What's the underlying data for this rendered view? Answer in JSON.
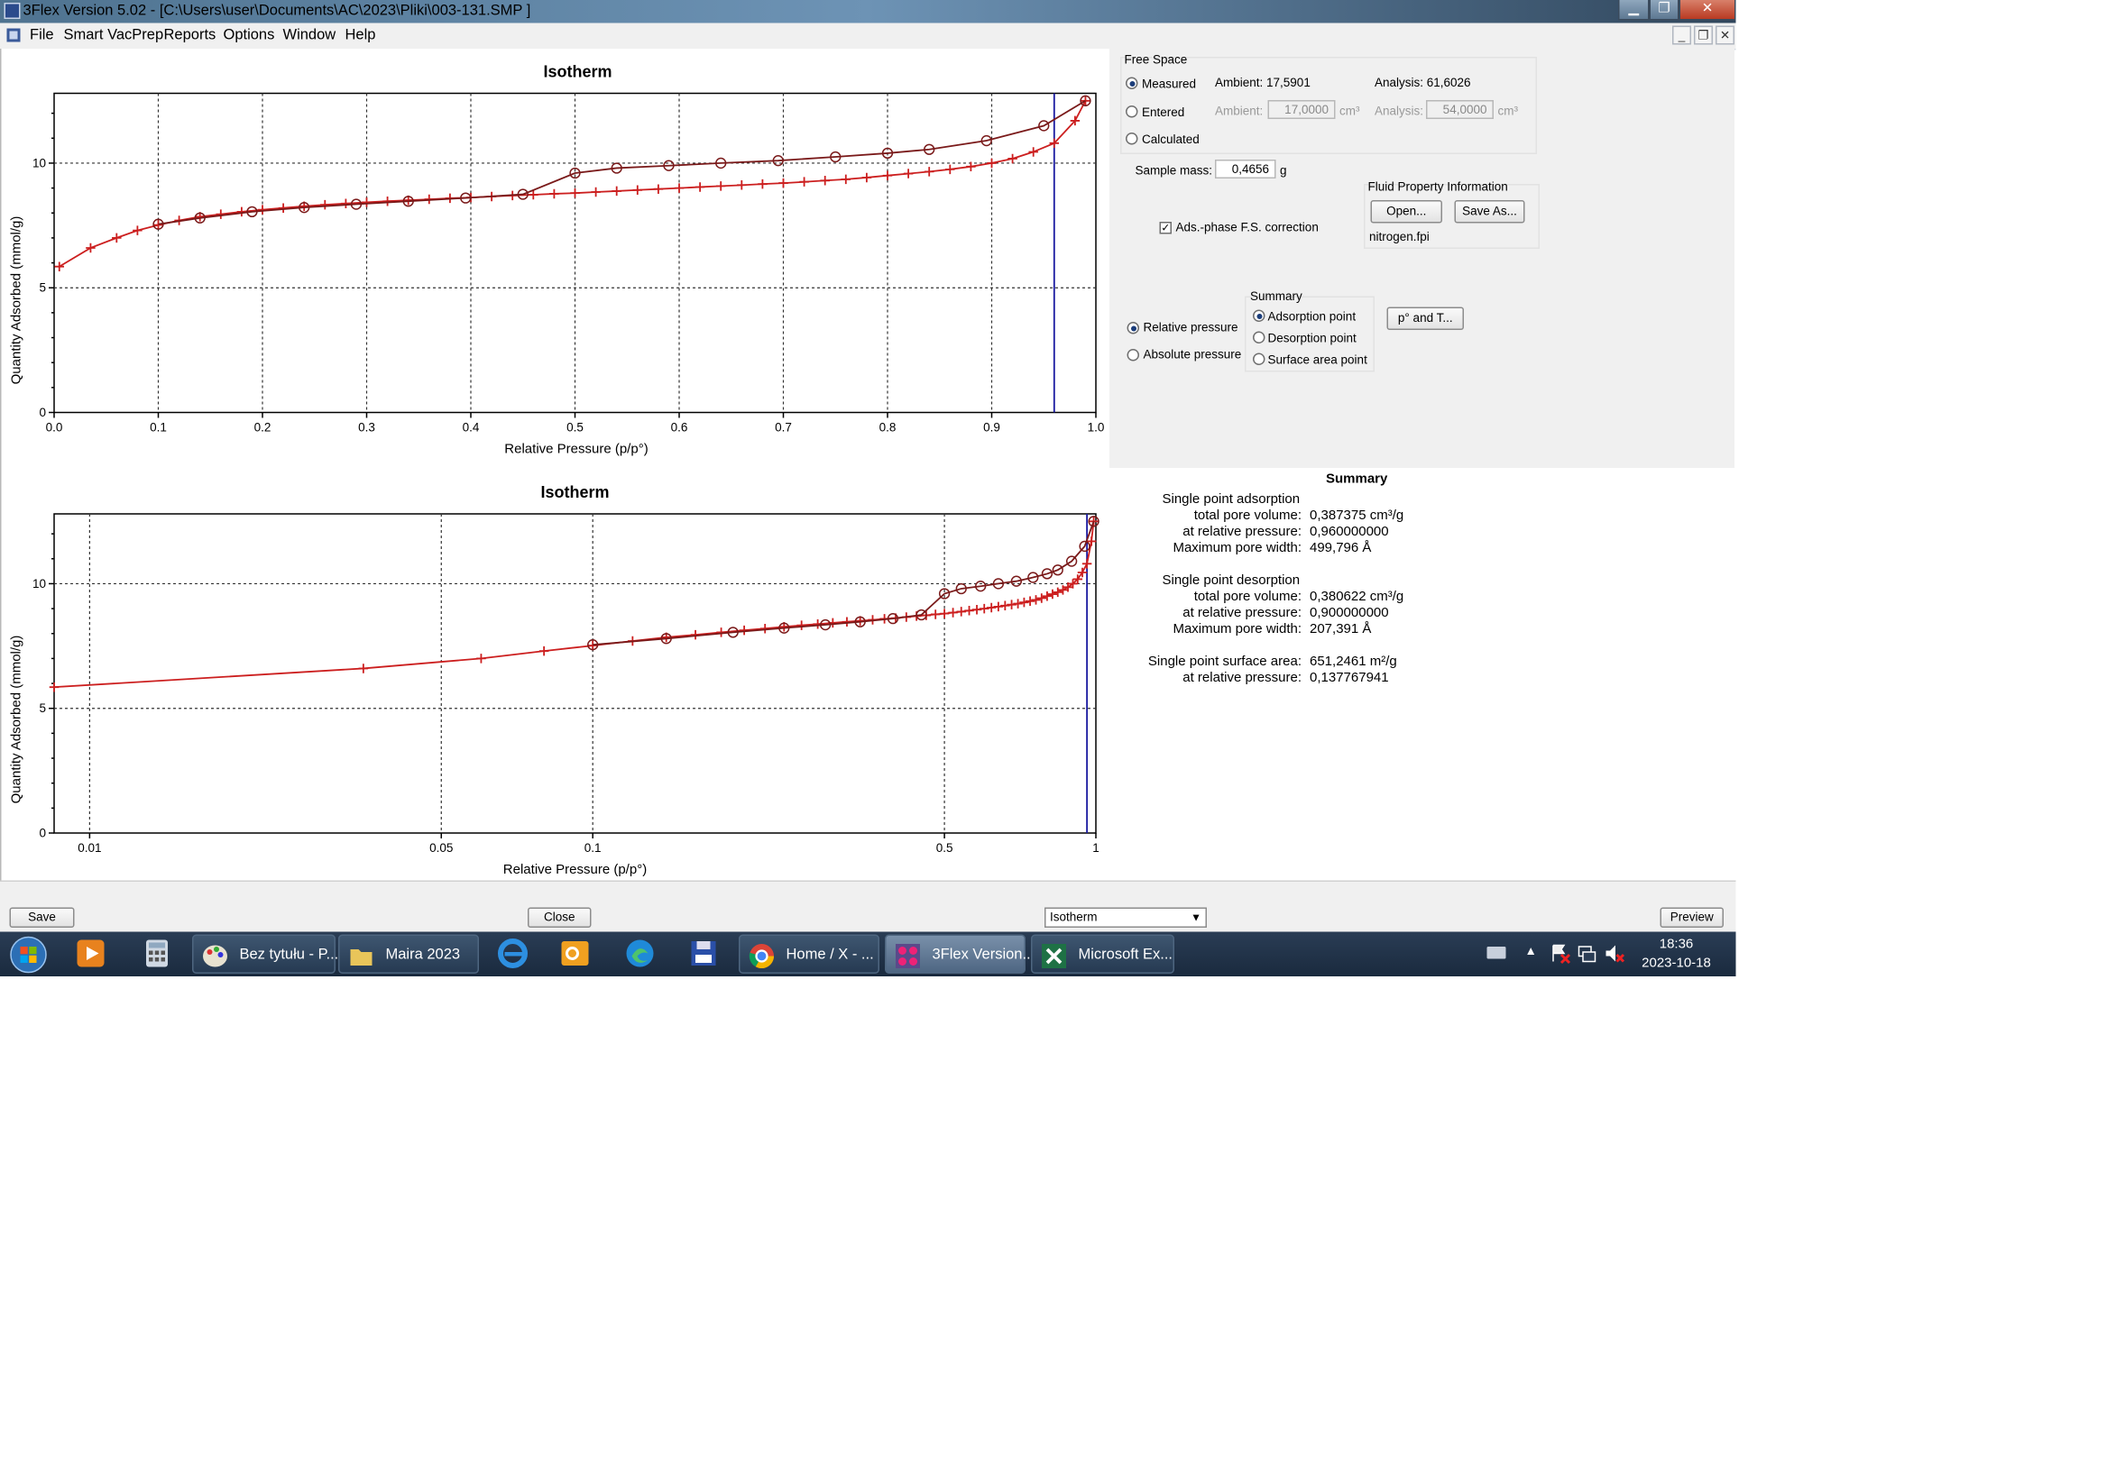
{
  "window": {
    "title": "3Flex Version 5.02 - [C:\\Users\\user\\Documents\\AC\\2023\\Pliki\\003-131.SMP ]"
  },
  "menu": [
    "File",
    "Smart VacPrep",
    "Reports",
    "Options",
    "Window",
    "Help"
  ],
  "free_space": {
    "label": "Free Space",
    "measured_label": "Measured",
    "measured_ambient": "Ambient: 17,5901",
    "measured_analysis": "Analysis: 61,6026",
    "entered_label": "Entered",
    "entered_ambient_label": "Ambient:",
    "entered_ambient_value": "17,0000",
    "entered_analysis_label": "Analysis:",
    "entered_analysis_value": "54,0000",
    "unit": "cm³",
    "calculated_label": "Calculated",
    "selected": "Measured"
  },
  "sample_mass": {
    "label": "Sample mass:",
    "value": "0,4656",
    "unit": "g"
  },
  "fluid": {
    "label": "Fluid Property Information",
    "open": "Open...",
    "save_as": "Save As...",
    "file": "nitrogen.fpi"
  },
  "ads_phase": {
    "label": "Ads.-phase F.S. correction",
    "checked": true
  },
  "pressure_mode": {
    "relative": "Relative pressure",
    "absolute": "Absolute pressure",
    "selected": "relative"
  },
  "summary_options": {
    "label": "Summary",
    "adsorption": "Adsorption point",
    "desorption": "Desorption point",
    "surface_area": "Surface area point",
    "selected": "adsorption"
  },
  "p0_button": "p° and T...",
  "summary": {
    "title": "Summary",
    "ads_header": "Single point adsorption",
    "ads_rows": [
      {
        "label": "total pore volume:",
        "value": "0,387375 cm³/g"
      },
      {
        "label": "at relative pressure:",
        "value": "0,960000000"
      },
      {
        "label": "Maximum pore width:",
        "value": "499,796 Å"
      }
    ],
    "des_header": "Single point desorption",
    "des_rows": [
      {
        "label": "total pore volume:",
        "value": "0,380622 cm³/g"
      },
      {
        "label": "at relative pressure:",
        "value": "0,900000000"
      },
      {
        "label": "Maximum pore width:",
        "value": "207,391 Å"
      }
    ],
    "sa_label": "Single point surface area:",
    "sa_value": "651,2461 m²/g",
    "sa_rp_label": "at relative pressure:",
    "sa_rp_value": "0,137767941"
  },
  "bottom": {
    "save": "Save",
    "close": "Close",
    "report_select": "Isotherm",
    "preview": "Preview"
  },
  "taskbar": {
    "tasks": [
      {
        "label": "Bez tytułu - P...",
        "icon": "paint-icon"
      },
      {
        "label": "Maira 2023",
        "icon": "folder-icon"
      },
      {
        "label": "Home / X - ...",
        "icon": "chrome-icon"
      },
      {
        "label": "3Flex Version...",
        "icon": "3flex-icon",
        "active": true
      },
      {
        "label": "Microsoft Ex...",
        "icon": "excel-icon"
      }
    ],
    "time": "18:36",
    "date": "2023-10-18"
  },
  "colors": {
    "adsorption": "#cc1f1f",
    "desorption": "#7a1a1a",
    "marker_line": "#1a1aa0"
  },
  "chart_data": [
    {
      "type": "line",
      "title": "Isotherm",
      "xlabel": "Relative Pressure (p/p°)",
      "ylabel": "Quantity Adsorbed (mmol/g)",
      "xlim": [
        0,
        1.0
      ],
      "ylim": [
        0,
        12.8
      ],
      "xticks": [
        "0.0",
        "0.1",
        "0.2",
        "0.3",
        "0.4",
        "0.5",
        "0.6",
        "0.7",
        "0.8",
        "0.9",
        "1.0"
      ],
      "yticks": [
        "0",
        "5",
        "10"
      ],
      "grid": true,
      "vline": 0.96,
      "series": [
        {
          "marker": "plus",
          "x": [
            0.005,
            0.035,
            0.06,
            0.08,
            0.1,
            0.12,
            0.14,
            0.16,
            0.18,
            0.2,
            0.22,
            0.24,
            0.26,
            0.28,
            0.3,
            0.32,
            0.34,
            0.36,
            0.38,
            0.4,
            0.42,
            0.44,
            0.46,
            0.48,
            0.5,
            0.52,
            0.54,
            0.56,
            0.58,
            0.6,
            0.62,
            0.64,
            0.66,
            0.68,
            0.7,
            0.72,
            0.74,
            0.76,
            0.78,
            0.8,
            0.82,
            0.84,
            0.86,
            0.88,
            0.9,
            0.92,
            0.94,
            0.96,
            0.98,
            0.99
          ],
          "y": [
            5.85,
            6.6,
            7.0,
            7.3,
            7.52,
            7.7,
            7.85,
            7.95,
            8.05,
            8.13,
            8.2,
            8.27,
            8.33,
            8.38,
            8.43,
            8.47,
            8.51,
            8.55,
            8.59,
            8.62,
            8.66,
            8.7,
            8.73,
            8.77,
            8.8,
            8.84,
            8.88,
            8.92,
            8.96,
            9.0,
            9.04,
            9.08,
            9.12,
            9.16,
            9.2,
            9.25,
            9.3,
            9.35,
            9.42,
            9.5,
            9.58,
            9.66,
            9.75,
            9.86,
            10.0,
            10.18,
            10.45,
            10.8,
            11.7,
            12.5
          ]
        },
        {
          "marker": "circle",
          "x": [
            0.1,
            0.14,
            0.19,
            0.24,
            0.29,
            0.34,
            0.395,
            0.45,
            0.5,
            0.54,
            0.59,
            0.64,
            0.695,
            0.75,
            0.8,
            0.84,
            0.895,
            0.95,
            0.99
          ],
          "y": [
            7.55,
            7.8,
            8.05,
            8.22,
            8.35,
            8.47,
            8.6,
            8.75,
            9.6,
            9.8,
            9.9,
            10.0,
            10.1,
            10.25,
            10.4,
            10.55,
            10.9,
            11.5,
            12.5
          ]
        }
      ]
    },
    {
      "type": "line",
      "title": "Isotherm",
      "xlabel": "Relative Pressure (p/p°)",
      "ylabel": "Quantity Adsorbed (mmol/g)",
      "xscale": "log",
      "xlim": [
        0.0085,
        1.0
      ],
      "ylim": [
        0,
        12.8
      ],
      "xticks": [
        "0.01",
        "0.05",
        "0.1",
        "0.5",
        "1"
      ],
      "yticks": [
        "0",
        "5",
        "10"
      ],
      "grid": true,
      "vline": 0.96,
      "series": [
        {
          "marker": "plus",
          "x": [
            0.0085,
            0.035,
            0.06,
            0.08,
            0.1,
            0.12,
            0.14,
            0.16,
            0.18,
            0.2,
            0.22,
            0.24,
            0.26,
            0.28,
            0.3,
            0.32,
            0.34,
            0.36,
            0.38,
            0.4,
            0.42,
            0.44,
            0.46,
            0.48,
            0.5,
            0.52,
            0.54,
            0.56,
            0.58,
            0.6,
            0.62,
            0.64,
            0.66,
            0.68,
            0.7,
            0.72,
            0.74,
            0.76,
            0.78,
            0.8,
            0.82,
            0.84,
            0.86,
            0.88,
            0.9,
            0.92,
            0.94,
            0.96,
            0.98,
            0.99
          ],
          "y": [
            5.85,
            6.6,
            7.0,
            7.3,
            7.52,
            7.7,
            7.85,
            7.95,
            8.05,
            8.13,
            8.2,
            8.27,
            8.33,
            8.38,
            8.43,
            8.47,
            8.51,
            8.55,
            8.59,
            8.62,
            8.66,
            8.7,
            8.73,
            8.77,
            8.8,
            8.84,
            8.88,
            8.92,
            8.96,
            9.0,
            9.04,
            9.08,
            9.12,
            9.16,
            9.2,
            9.25,
            9.3,
            9.35,
            9.42,
            9.5,
            9.58,
            9.66,
            9.75,
            9.86,
            10.0,
            10.18,
            10.45,
            10.8,
            11.7,
            12.5
          ]
        },
        {
          "marker": "circle",
          "x": [
            0.1,
            0.14,
            0.19,
            0.24,
            0.29,
            0.34,
            0.395,
            0.45,
            0.5,
            0.54,
            0.59,
            0.64,
            0.695,
            0.75,
            0.8,
            0.84,
            0.895,
            0.95,
            0.99
          ],
          "y": [
            7.55,
            7.8,
            8.05,
            8.22,
            8.35,
            8.47,
            8.6,
            8.75,
            9.6,
            9.8,
            9.9,
            10.0,
            10.1,
            10.25,
            10.4,
            10.55,
            10.9,
            11.5,
            12.5
          ]
        }
      ]
    }
  ]
}
